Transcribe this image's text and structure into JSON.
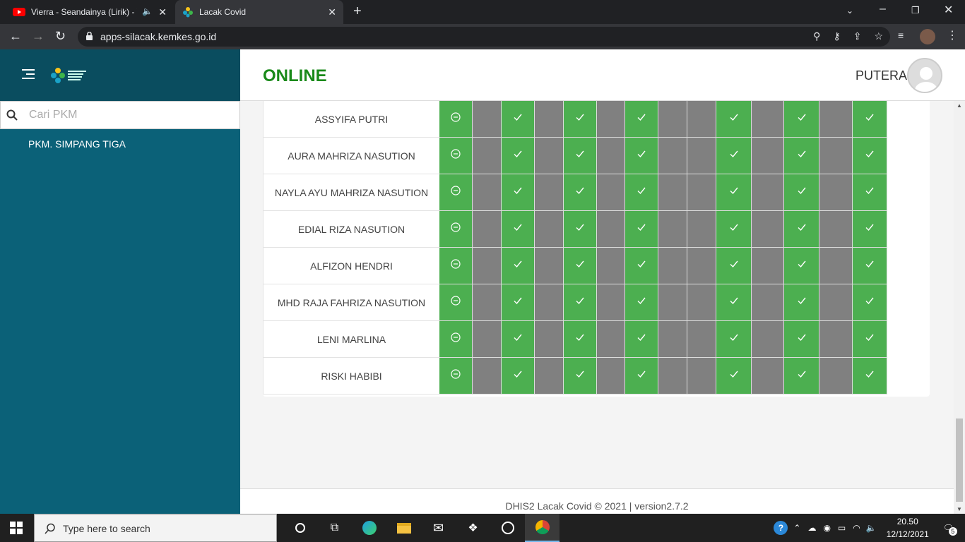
{
  "browser": {
    "tabs": [
      {
        "title": "Vierra - Seandainya (Lirik) - Y"
      },
      {
        "title": "Lacak Covid"
      }
    ],
    "url": "apps-silacak.kemkes.go.id"
  },
  "sidebar": {
    "search_placeholder": "Cari PKM",
    "items": [
      {
        "label": "PKM. SIMPANG TIGA"
      }
    ]
  },
  "header": {
    "status": "ONLINE",
    "user": "PUTERA"
  },
  "table": {
    "columns": [
      "green-minus",
      "grey",
      "green-check",
      "grey",
      "green-check",
      "grey",
      "green-check",
      "grey",
      "grey",
      "green-check",
      "grey",
      "green-check",
      "grey",
      "green-check"
    ],
    "rows": [
      {
        "name": "ASSYIFA PUTRI"
      },
      {
        "name": "AURA MAHRIZA NASUTION"
      },
      {
        "name": "NAYLA AYU MAHRIZA NASUTION"
      },
      {
        "name": "EDIAL RIZA NASUTION"
      },
      {
        "name": "ALFIZON HENDRI"
      },
      {
        "name": "MHD RAJA FAHRIZA NASUTION"
      },
      {
        "name": "LENI MARLINA"
      },
      {
        "name": "RISKI HABIBI"
      }
    ]
  },
  "footer": {
    "text": "DHIS2 Lacak Covid © 2021 | version2.7.2"
  },
  "taskbar": {
    "search_text": "Type here to search",
    "time": "20.50",
    "date": "12/12/2021",
    "notif_count": "5"
  },
  "colors": {
    "green": "#4caf50",
    "grey": "#808080",
    "sidebar": "#0b6178",
    "online": "#1a8a1a"
  }
}
